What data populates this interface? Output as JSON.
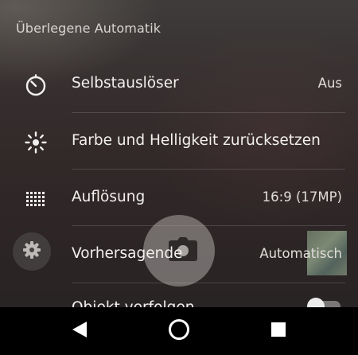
{
  "section_header": "Überlegene Automatik",
  "settings": [
    {
      "label": "Selbstauslöser",
      "value": "Aus",
      "icon": "timer-icon"
    },
    {
      "label": "Farbe und Helligkeit zurücksetzen",
      "value": "",
      "icon": "brightness-icon"
    },
    {
      "label": "Auflösung",
      "value": "16:9 (17MP)",
      "icon": "resolution-grid-icon"
    },
    {
      "label": "Vorhersagende",
      "value": "Automatisch",
      "icon": ""
    }
  ],
  "partial_item": {
    "label": "Objekt verfolgen",
    "toggle_on": false
  },
  "camera": {
    "settings_icon": "gear-icon",
    "shutter_icon": "camera-icon",
    "thumbnail": "last-photo-thumbnail"
  },
  "navbar": {
    "back_icon": "back-triangle-icon",
    "home_icon": "home-circle-icon",
    "recents_icon": "recents-square-icon"
  },
  "colors": {
    "text_primary": "#f2f0ee",
    "nav_background": "#000000"
  }
}
